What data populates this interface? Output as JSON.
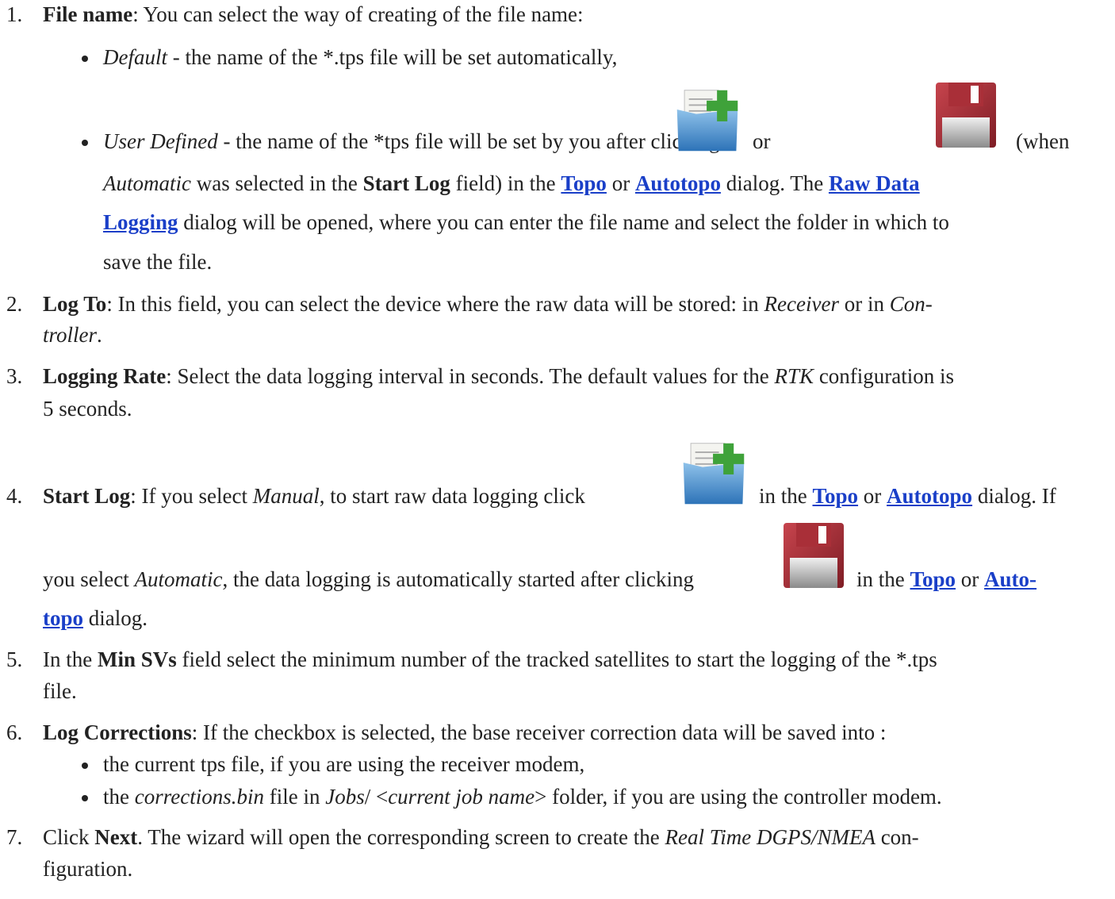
{
  "items": [
    {
      "num": "1.",
      "label": "File name",
      "text": ": You can select the way of creating of the file name:",
      "bullets": {
        "default_term": "Default",
        "default_text": " - the name of the *.tps file will be set automatically,",
        "user_term": "User Defined",
        "user_text_a": " - the name of the *tps file will be set by you after clicking",
        "user_or": "or",
        "user_when": "(when",
        "user_line2_a": "Automatic",
        "user_line2_b": " was selected in the ",
        "user_line2_c": "Start Log",
        "user_line2_d": " field) in the ",
        "user_line2_e": " or ",
        "user_line2_f": " dialog. The ",
        "user_line3_b": " dialog will be opened, where you can enter the file name and select the folder in which to",
        "user_line4": "save the file."
      }
    },
    {
      "num": "2.",
      "label": "Log To",
      "text_a": ": In this field, you can select the device where the raw data will be stored: in ",
      "term1": "Receiver",
      "text_b": " or in ",
      "term2": "Con-",
      "line2": "troller",
      "line2_end": "."
    },
    {
      "num": "3.",
      "label": "Logging Rate",
      "text_a": ": Select the data logging interval in seconds. The default values for the ",
      "term": "RTK",
      "text_b": " configuration is",
      "line2": "5 seconds."
    },
    {
      "num": "4.",
      "label": "Start Log",
      "text_a": ": If you select ",
      "term1": "Manual",
      "text_b": ", to start raw data logging click",
      "text_c": "in the ",
      "text_d": " or ",
      "text_e": " dialog. If",
      "line2_a": "you select ",
      "term2": "Automatic",
      "line2_b": ", the data logging is automatically started after clicking",
      "line2_c": "in the ",
      "line2_d": " or ",
      "line2_link": "Auto-",
      "line3_link": "topo",
      "line3_end": " dialog."
    },
    {
      "num": "5.",
      "text_a": "In the ",
      "label": "Min SVs",
      "text_b": " field select the minimum number of the tracked satellites to start the logging of the *.tps",
      "line2": "file."
    },
    {
      "num": "6.",
      "label": "Log Corrections",
      "text": ": If the checkbox is selected, the base receiver correction data will be saved into :",
      "bullet1": "the current tps file, if you are using the receiver modem,",
      "bullet2_a": "the ",
      "bullet2_term1": "corrections.bin",
      "bullet2_b": " file in ",
      "bullet2_term2": "Jobs",
      "bullet2_c": "/ <",
      "bullet2_term3": "current job name",
      "bullet2_d": "> folder, if you are using the controller modem."
    },
    {
      "num": "7.",
      "text_a": "Click ",
      "label": "Next",
      "text_b": ". The wizard will open the corresponding screen to create the ",
      "term": "Real Time DGPS/NMEA",
      "text_c": " con-",
      "line2": "figuration."
    }
  ],
  "links": {
    "topo": "Topo",
    "autotopo": "Autotopo",
    "raw_data": "Raw Data ",
    "logging": "Logging"
  },
  "icons": {
    "start_log": "new-log-folder-icon",
    "save": "floppy-save-icon"
  },
  "colors": {
    "link": "#1a3fc8",
    "text": "#222222"
  }
}
